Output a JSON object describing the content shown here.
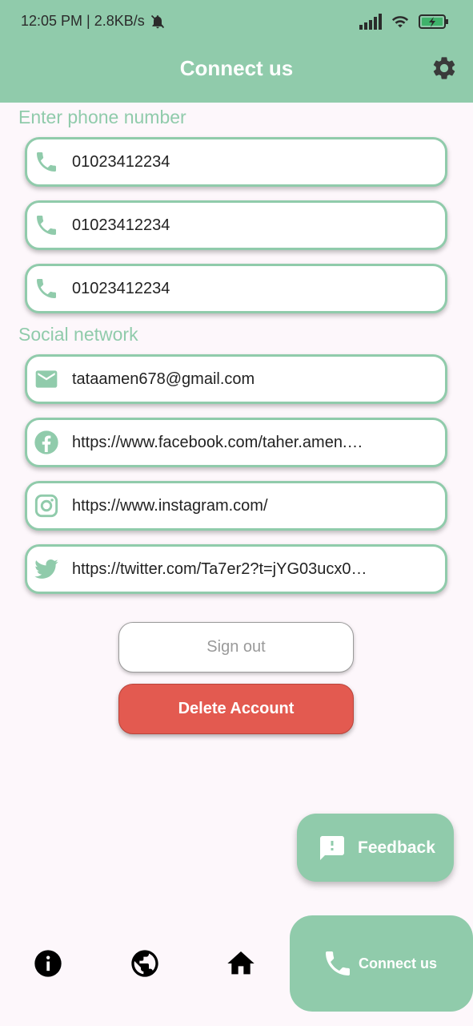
{
  "status_bar": {
    "time_speed": "12:05 PM | 2.8KB/s"
  },
  "header": {
    "title": "Connect us"
  },
  "phone_section": {
    "label": "Enter phone number",
    "phones": [
      "01023412234",
      "01023412234",
      "01023412234"
    ]
  },
  "social_section": {
    "label": "Social network",
    "email": "tataamen678@gmail.com",
    "facebook": "https://www.facebook.com/taher.amen.…",
    "instagram": "https://www.instagram.com/",
    "twitter": "https://twitter.com/Ta7er2?t=jYG03ucx0…"
  },
  "actions": {
    "sign_out": "Sign out",
    "delete_account": "Delete Account"
  },
  "fab": {
    "label": "Feedback"
  },
  "bottom_nav": {
    "active_label": "Connect us",
    "items": [
      "info-icon",
      "globe-icon",
      "home-icon",
      "phone-icon"
    ]
  },
  "colors": {
    "accent": "#90cbab",
    "danger": "#e35a50",
    "background": "#fdf7fb"
  }
}
